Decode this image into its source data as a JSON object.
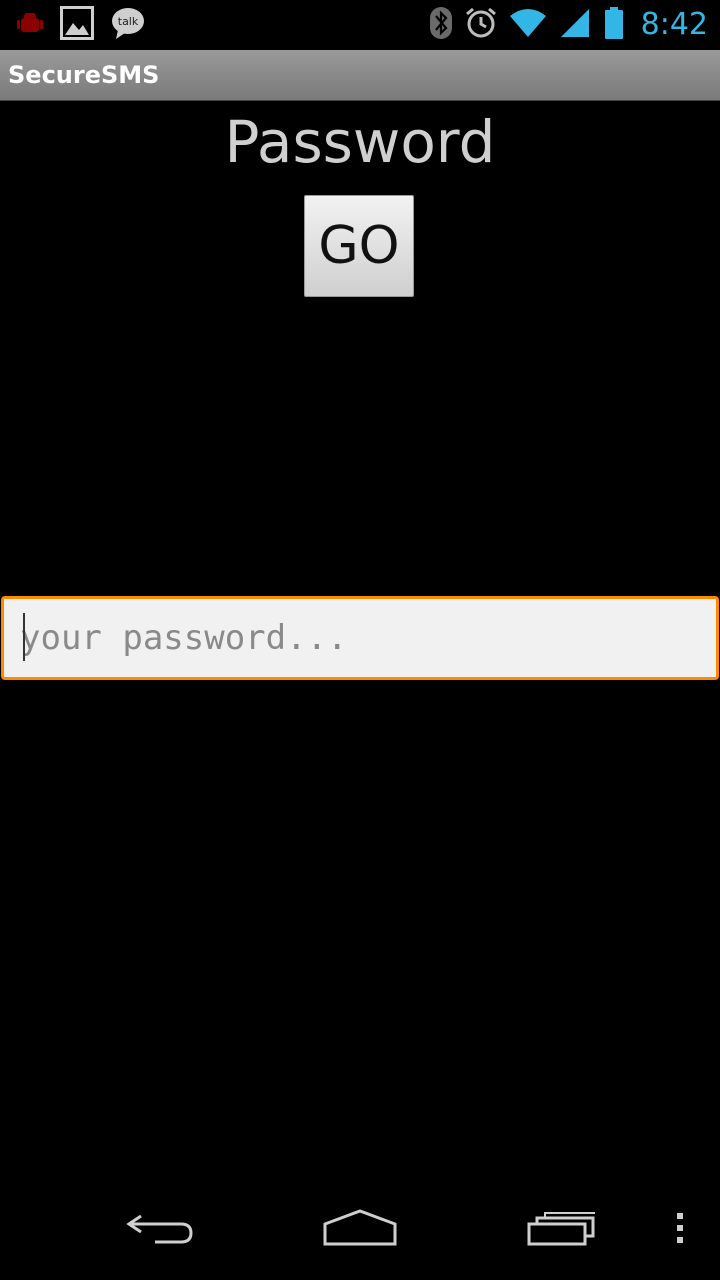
{
  "status_bar": {
    "time": "8:42",
    "icons": [
      "android-debug-icon",
      "gallery-icon",
      "talk-icon",
      "bluetooth-icon",
      "alarm-icon",
      "wifi-icon",
      "signal-icon",
      "battery-icon"
    ],
    "talk_label": "talk",
    "clock_color": "#33b5e5"
  },
  "app": {
    "title": "SecureSMS"
  },
  "main": {
    "heading": "Password",
    "go_label": "GO",
    "password_placeholder": "your password...",
    "password_value": "",
    "focus_color": "#ff8a00"
  },
  "nav": {
    "buttons": [
      "back-icon",
      "home-icon",
      "recent-apps-icon",
      "menu-overflow-icon"
    ]
  }
}
